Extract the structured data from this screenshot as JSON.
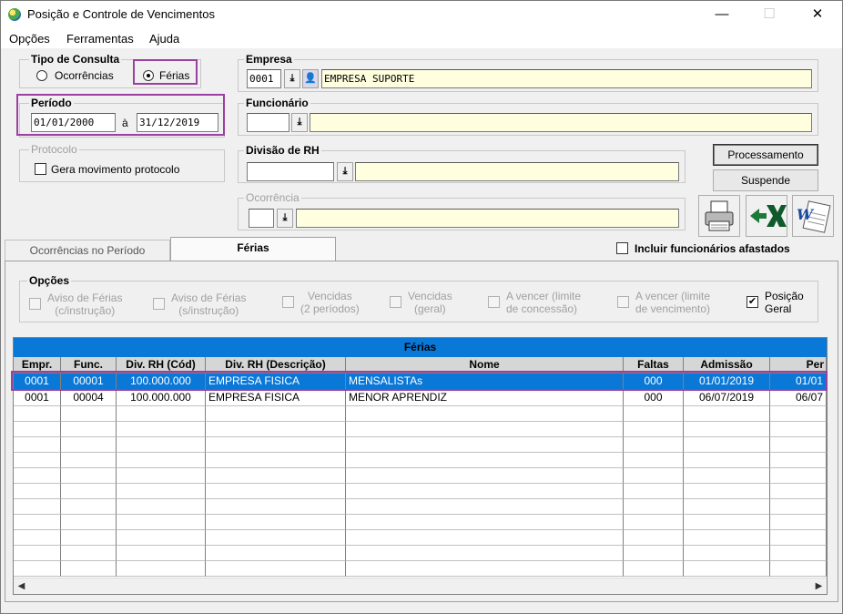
{
  "window": {
    "title": "Posição e Controle de Vencimentos",
    "minimize": "—",
    "maximize": "☐",
    "close": "✕"
  },
  "menu": [
    "Opções",
    "Ferramentas",
    "Ajuda"
  ],
  "tipo_consulta": {
    "title": "Tipo de Consulta",
    "options": [
      {
        "label": "Ocorrências",
        "selected": false
      },
      {
        "label": "Férias",
        "selected": true
      }
    ]
  },
  "periodo": {
    "title": "Período",
    "start": "01/01/2000",
    "separator": "à",
    "end": "31/12/2019"
  },
  "protocolo": {
    "title": "Protocolo",
    "checkbox_label": "Gera movimento protocolo"
  },
  "empresa": {
    "title": "Empresa",
    "code": "0001",
    "name": "EMPRESA SUPORTE"
  },
  "funcionario": {
    "title": "Funcionário",
    "code": "",
    "name": ""
  },
  "divisao_rh": {
    "title": "Divisão de RH",
    "code": "",
    "name": ""
  },
  "ocorrencia": {
    "title": "Ocorrência",
    "code": "",
    "name": ""
  },
  "buttons": {
    "processamento": "Processamento",
    "suspende": "Suspende"
  },
  "tabs": [
    {
      "label": "Ocorrências no Período",
      "active": false
    },
    {
      "label": "Férias",
      "active": true
    }
  ],
  "incluir_afastados": "Incluir funcionários afastados",
  "opcoes": {
    "title": "Opções",
    "items": [
      {
        "line1": "Aviso de Férias",
        "line2": "(c/instrução)",
        "checked": false,
        "enabled": false
      },
      {
        "line1": "Aviso de Férias",
        "line2": "(s/instrução)",
        "checked": false,
        "enabled": false
      },
      {
        "line1": "Vencidas",
        "line2": "(2 períodos)",
        "checked": false,
        "enabled": false
      },
      {
        "line1": "Vencidas",
        "line2": "(geral)",
        "checked": false,
        "enabled": false
      },
      {
        "line1": "A vencer (limite",
        "line2": "de concessão)",
        "checked": false,
        "enabled": false
      },
      {
        "line1": "A vencer (limite",
        "line2": "de vencimento)",
        "checked": false,
        "enabled": false
      },
      {
        "line1": "Posição",
        "line2": "Geral",
        "checked": true,
        "enabled": true
      }
    ]
  },
  "grid": {
    "title": "Férias",
    "columns": [
      "Empr.",
      "Func.",
      "Div. RH (Cód)",
      "Div. RH (Descrição)",
      "Nome",
      "Faltas",
      "Admissão",
      "Per"
    ],
    "rows": [
      [
        "0001",
        "00001",
        "100.000.000",
        "EMPRESA FISICA",
        "MENSALISTAs",
        "000",
        "01/01/2019",
        "01/01"
      ],
      [
        "0001",
        "00004",
        "100.000.000",
        "EMPRESA FISICA",
        "MENOR APRENDIZ",
        "000",
        "06/07/2019",
        "06/07"
      ]
    ],
    "selected_row": 0
  },
  "colors": {
    "highlight": "#9b3fa0",
    "selection": "#0a78d7",
    "field_yellow": "#ffffe0"
  }
}
